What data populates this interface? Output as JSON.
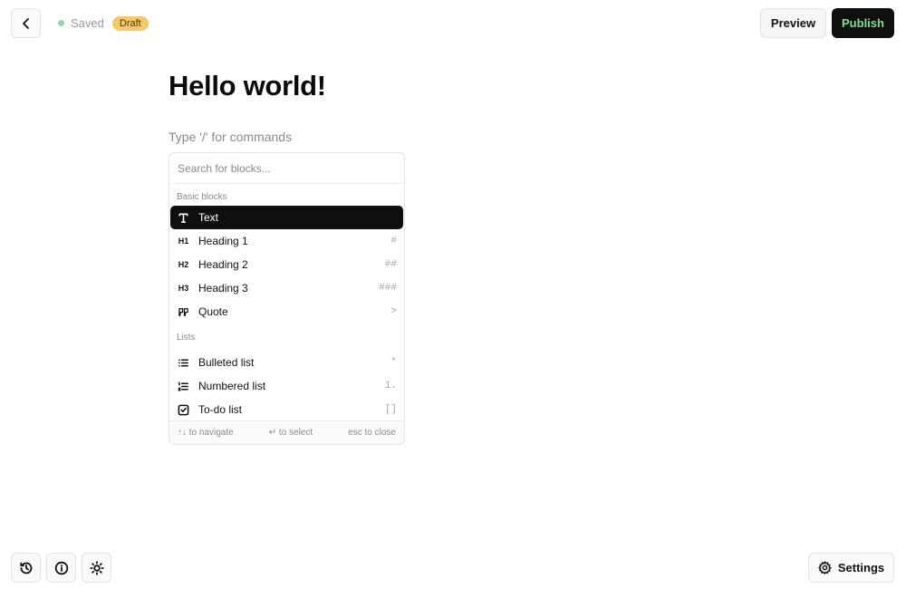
{
  "header": {
    "back_icon": "chevron-left-icon",
    "save_status": "Saved",
    "status_color": "#8fd9a8",
    "badge": "Draft",
    "badge_color": "#f5c86a",
    "preview_label": "Preview",
    "publish_label": "Publish",
    "publish_text_color": "#7ee08f"
  },
  "document": {
    "title": "Hello world!",
    "command_hint": "Type '/' for commands"
  },
  "block_menu": {
    "search_placeholder": "Search for blocks...",
    "groups": [
      {
        "label": "Basic blocks",
        "items": [
          {
            "label": "Text",
            "icon": "text-t-icon",
            "shortcut": "",
            "selected": true
          },
          {
            "label": "Heading 1",
            "icon": "heading-1-icon",
            "icon_text": "H1",
            "shortcut": "#"
          },
          {
            "label": "Heading 2",
            "icon": "heading-2-icon",
            "icon_text": "H2",
            "shortcut": "##"
          },
          {
            "label": "Heading 3",
            "icon": "heading-3-icon",
            "icon_text": "H3",
            "shortcut": "###"
          },
          {
            "label": "Quote",
            "icon": "quote-icon",
            "shortcut": ">"
          }
        ]
      },
      {
        "label": "Lists",
        "items": [
          {
            "label": "Bulleted list",
            "icon": "bulleted-list-icon",
            "shortcut": "*"
          },
          {
            "label": "Numbered list",
            "icon": "numbered-list-icon",
            "shortcut": "1."
          },
          {
            "label": "To-do list",
            "icon": "checkbox-icon",
            "shortcut": "[]"
          }
        ]
      }
    ],
    "footer": {
      "navigate": "↑↓ to navigate",
      "select": "↵ to select",
      "close": "esc to close"
    }
  },
  "bottom_bar": {
    "history_icon": "history-icon",
    "info_icon": "info-icon",
    "theme_icon": "sun-icon",
    "settings_label": "Settings",
    "settings_icon": "gear-icon"
  }
}
